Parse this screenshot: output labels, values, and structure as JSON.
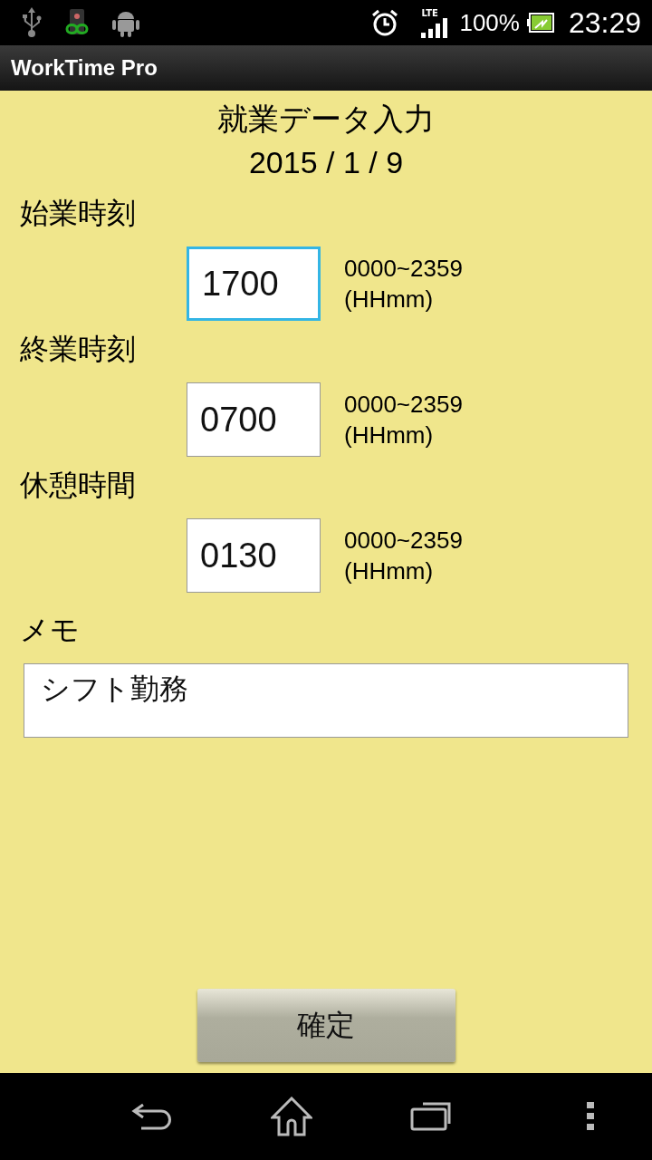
{
  "status_bar": {
    "battery": "100%",
    "time": "23:29",
    "network": "LTE"
  },
  "app_bar": {
    "title": "WorkTime Pro"
  },
  "heading": "就業データ入力",
  "date": "2015 / 1 / 9",
  "time_fields": [
    {
      "label": "始業時刻",
      "value": "1700",
      "hint_1": "0000~2359",
      "hint_2": "(HHmm)",
      "focused": true
    },
    {
      "label": "終業時刻",
      "value": "0700",
      "hint_1": "0000~2359",
      "hint_2": "(HHmm)",
      "focused": false
    },
    {
      "label": "休憩時間",
      "value": "0130",
      "hint_1": "0000~2359",
      "hint_2": "(HHmm)",
      "focused": false
    }
  ],
  "memo": {
    "label": "メモ",
    "value": "シフト勤務"
  },
  "confirm_button": "確定"
}
